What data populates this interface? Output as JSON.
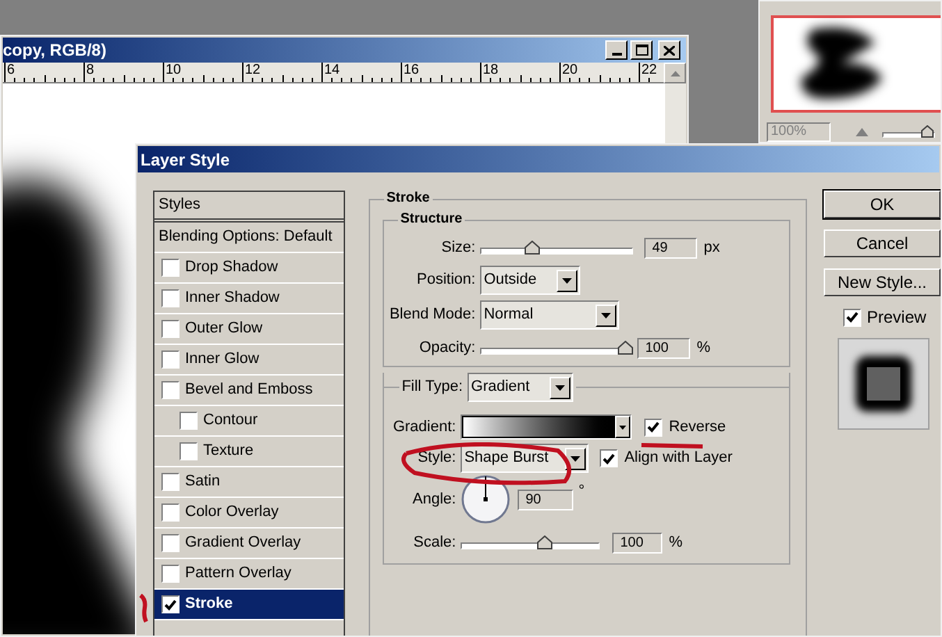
{
  "document": {
    "title": "copy, RGB/8)",
    "ruler": [
      "6",
      "8",
      "10",
      "12",
      "14",
      "16",
      "18",
      "20",
      "22"
    ]
  },
  "navigator": {
    "zoom": "100%",
    "level": 0.95
  },
  "dialog": {
    "title": "Layer Style",
    "styles_list": [
      {
        "label": "Styles",
        "kind": "header",
        "selected": false
      },
      {
        "label": "Blending Options: Default",
        "kind": "header",
        "selected": false
      },
      {
        "label": "Drop Shadow",
        "kind": "effect",
        "checked": false,
        "selected": false
      },
      {
        "label": "Inner Shadow",
        "kind": "effect",
        "checked": false,
        "selected": false
      },
      {
        "label": "Outer Glow",
        "kind": "effect",
        "checked": false,
        "selected": false
      },
      {
        "label": "Inner Glow",
        "kind": "effect",
        "checked": false,
        "selected": false
      },
      {
        "label": "Bevel and Emboss",
        "kind": "effect",
        "checked": false,
        "selected": false,
        "children": [
          {
            "label": "Contour",
            "kind": "effect",
            "checked": false,
            "selected": false
          },
          {
            "label": "Texture",
            "kind": "effect",
            "checked": false,
            "selected": false
          }
        ]
      },
      {
        "label": "Satin",
        "kind": "effect",
        "checked": false,
        "selected": false
      },
      {
        "label": "Color Overlay",
        "kind": "effect",
        "checked": false,
        "selected": false
      },
      {
        "label": "Gradient Overlay",
        "kind": "effect",
        "checked": false,
        "selected": false
      },
      {
        "label": "Pattern Overlay",
        "kind": "effect",
        "checked": false,
        "selected": false
      },
      {
        "label": "Stroke",
        "kind": "effect",
        "checked": true,
        "selected": true
      }
    ],
    "stroke": {
      "title": "Stroke",
      "structure": {
        "title": "Structure",
        "size": {
          "label": "Size:",
          "level": 0.33,
          "value": "49",
          "unit": "px"
        },
        "position": {
          "label": "Position:",
          "value": "Outside"
        },
        "blend_mode": {
          "label": "Blend Mode:",
          "value": "Normal"
        },
        "opacity": {
          "label": "Opacity:",
          "level": 1,
          "value": "100",
          "unit": "%"
        }
      },
      "fill": {
        "label": "Fill Type:",
        "value": "Gradient",
        "gradient": {
          "label": "Gradient:"
        },
        "reverse": {
          "label": "Reverse",
          "checked": true
        },
        "style": {
          "label": "Style:",
          "value": "Shape Burst"
        },
        "align": {
          "label": "Align with Layer",
          "checked": true
        },
        "angle": {
          "label": "Angle:",
          "value": "90",
          "unit": "°"
        },
        "scale": {
          "label": "Scale:",
          "level": 0.62,
          "value": "100",
          "unit": "%"
        }
      }
    },
    "buttons": [
      "OK",
      "Cancel",
      "New Style..."
    ],
    "preview": {
      "label": "Preview",
      "checked": true
    }
  }
}
